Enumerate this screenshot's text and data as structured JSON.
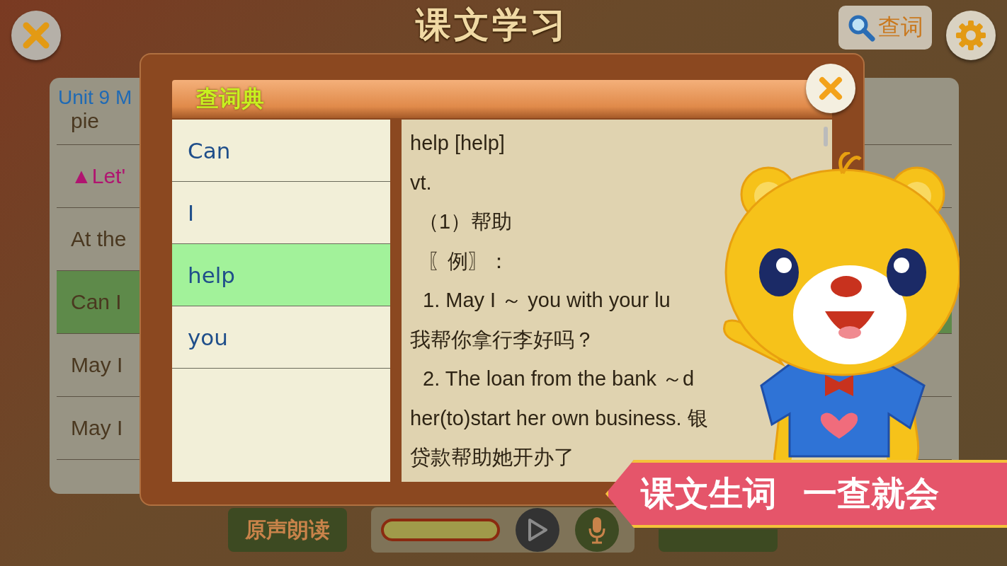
{
  "top_bar": {
    "title": "课文学习",
    "search_button": "查词"
  },
  "lesson_list": {
    "heading": "Unit 9 M",
    "rows": [
      {
        "text": "pie",
        "kind": "plain",
        "selected": false
      },
      {
        "text": "▲Let'",
        "kind": "section",
        "selected": false
      },
      {
        "text": "At the",
        "kind": "plain",
        "selected": false
      },
      {
        "text": "Can I",
        "kind": "plain",
        "selected": true
      },
      {
        "text": "May I",
        "kind": "plain",
        "selected": false
      },
      {
        "text": "May I",
        "kind": "plain",
        "selected": false
      }
    ]
  },
  "dictionary": {
    "title": "查词典",
    "words": [
      {
        "text": "Can",
        "selected": false
      },
      {
        "text": "I",
        "selected": false
      },
      {
        "text": "help",
        "selected": true
      },
      {
        "text": "you",
        "selected": false
      }
    ],
    "definition": [
      {
        "text": "help  [help]",
        "kind": "headword"
      },
      {
        "text": "vt.",
        "kind": "pos"
      },
      {
        "text": "（1）帮助",
        "kind": "sense"
      },
      {
        "text": "〖例〗：",
        "kind": "label"
      },
      {
        "text": "1. May I ～ you with your lu",
        "kind": "example"
      },
      {
        "text": "我帮你拿行李好吗？",
        "kind": "translation"
      },
      {
        "text": "2. The loan from the bank ～d",
        "kind": "example"
      },
      {
        "text": "her(to)start her own business. 银",
        "kind": "translation"
      },
      {
        "text": "贷款帮助她开办了",
        "kind": "translation"
      }
    ]
  },
  "bottom_bar": {
    "original_button": "原声朗读"
  },
  "banner": {
    "text": "课文生词 一查就会"
  }
}
